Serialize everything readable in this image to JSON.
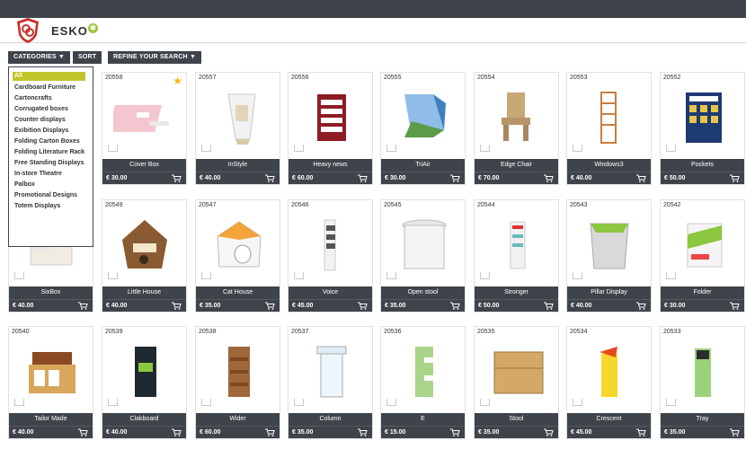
{
  "header": {
    "brand": "ESKO"
  },
  "toolbar": {
    "categories": "CATEGORIES ▼",
    "sort": "SORT",
    "refine": "REFINE YOUR SEARCH ▼"
  },
  "categories": [
    "All",
    "Cardboard Furniture",
    "Cartoncrafts",
    "Corrugated boxes",
    "Counter displays",
    "Exibition Displays",
    "Folding Carton Boxes",
    "Folding Literature Rack",
    "Free Standing Displays",
    "In-store Theatre",
    "Palbox",
    "Promotional Designs",
    "Totem Displays"
  ],
  "products": [
    {
      "id": "20558",
      "name": "Cover Box",
      "price": "€ 30.00",
      "fav": true
    },
    {
      "id": "20557",
      "name": "InStyle",
      "price": "€ 40.00"
    },
    {
      "id": "20556",
      "name": "Heavy news",
      "price": "€ 60.00"
    },
    {
      "id": "20555",
      "name": "TriAir",
      "price": "€ 30.00"
    },
    {
      "id": "20554",
      "name": "Edge Chair",
      "price": "€ 70.00"
    },
    {
      "id": "20553",
      "name": "Windows3",
      "price": "€ 40.00"
    },
    {
      "id": "20552",
      "name": "Pockets",
      "price": "€ 50.00"
    },
    {
      "id": "",
      "name": "SixBox",
      "price": "€ 40.00"
    },
    {
      "id": "20549",
      "name": "Little House",
      "price": "€ 40.00"
    },
    {
      "id": "20547",
      "name": "Cat House",
      "price": "€ 35.00"
    },
    {
      "id": "20546",
      "name": "Voice",
      "price": "€ 45.00"
    },
    {
      "id": "20545",
      "name": "Open stool",
      "price": "€ 35.00"
    },
    {
      "id": "20544",
      "name": "Stronger",
      "price": "€ 50.00"
    },
    {
      "id": "20543",
      "name": "Pillar Display",
      "price": "€ 40.00"
    },
    {
      "id": "20542",
      "name": "Folder",
      "price": "€ 30.00"
    },
    {
      "id": "20540",
      "name": "Tailor Made",
      "price": "€ 40.00"
    },
    {
      "id": "20539",
      "name": "Clakboard",
      "price": "€ 40.00"
    },
    {
      "id": "20538",
      "name": "Wider",
      "price": "€ 60.00"
    },
    {
      "id": "20537",
      "name": "Column",
      "price": "€ 35.00"
    },
    {
      "id": "20536",
      "name": "E",
      "price": "€ 15.00"
    },
    {
      "id": "20535",
      "name": "Stool",
      "price": "€ 35.00"
    },
    {
      "id": "20534",
      "name": "Crescent",
      "price": "€ 45.00"
    },
    {
      "id": "20533",
      "name": "Tray",
      "price": "€ 35.00"
    }
  ],
  "colors": {
    "bar": "#3f444b",
    "accent": "#c0c62a",
    "star": "#f3b71b"
  }
}
